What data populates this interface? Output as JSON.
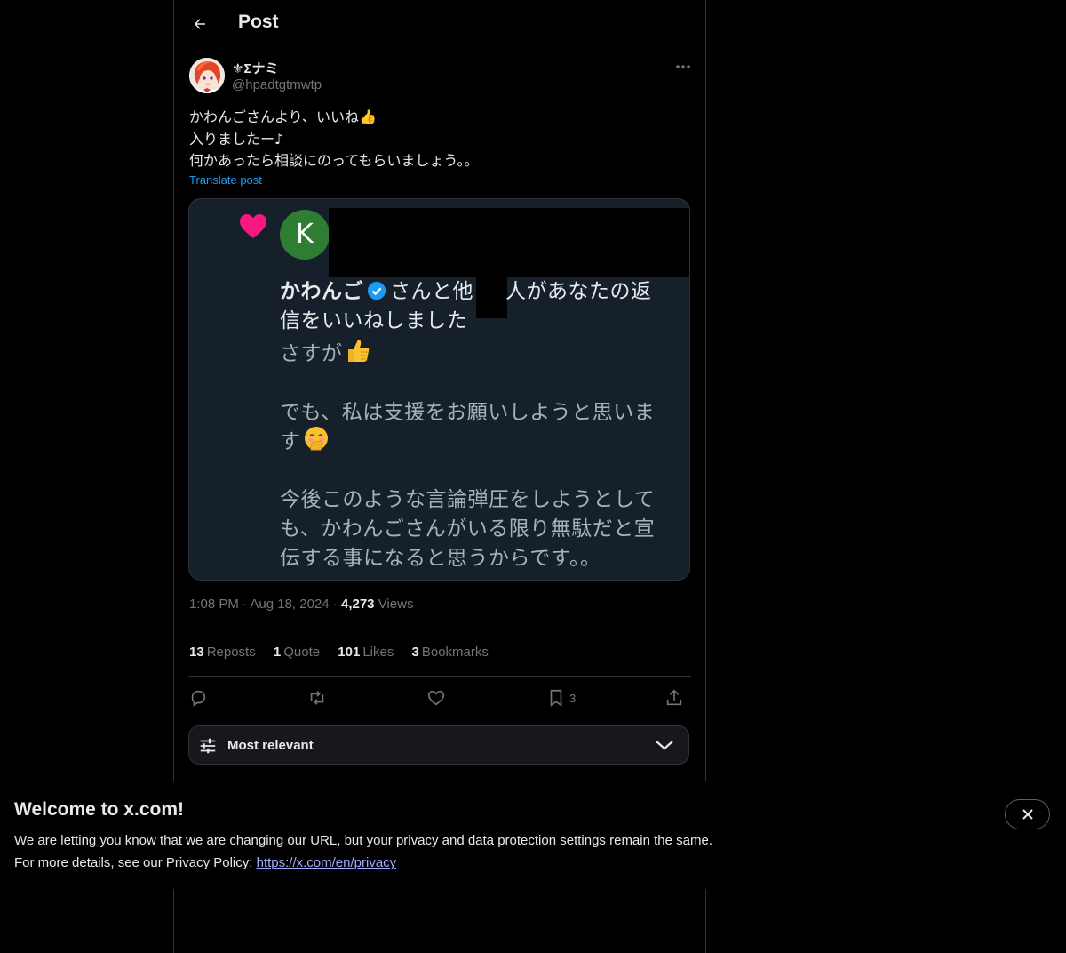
{
  "header": {
    "title": "Post"
  },
  "post": {
    "author": {
      "name": "⚜Σナミ",
      "handle": "@hpadtgtmwtp"
    },
    "text_lines": [
      "かわんごさんより、いいね👍",
      "入りましたー♪",
      "何かあったら相談にのってもらいましょう。。"
    ],
    "translate_label": "Translate post",
    "media": {
      "avatar_letter": "K",
      "notification_name": "かわんご",
      "notification_rest": "さんと他",
      "notification_tail": "人があなたの返",
      "notification_line2": "信をいいねしました",
      "reply_line1": "さすが",
      "reply_line2": "でも、私は支援をお願いしようと思いま",
      "reply_line3": "す",
      "reply_line4": "今後このような言論弾圧をしようとして",
      "reply_line5": "も、かわんごさんがいる限り無駄だと宣",
      "reply_line6": "伝する事になると思うからです。。"
    },
    "time": "1:08 PM",
    "date": "Aug 18, 2024",
    "views_count": "4,273",
    "views_label": "Views",
    "separator": "·",
    "stats": [
      {
        "count": "13",
        "label": "Reposts"
      },
      {
        "count": "1",
        "label": "Quote"
      },
      {
        "count": "101",
        "label": "Likes"
      },
      {
        "count": "3",
        "label": "Bookmarks"
      }
    ],
    "actions": {
      "reply_icon": "reply-icon",
      "repost_icon": "repost-icon",
      "like_icon": "heart-icon",
      "bookmark_icon": "bookmark-icon",
      "bookmark_count": "3",
      "share_icon": "share-icon"
    }
  },
  "sort": {
    "label": "Most relevant"
  },
  "banner": {
    "title": "Welcome to x.com!",
    "text1": "We are letting you know that we are changing our URL, but your privacy and data protection settings remain the same.",
    "text2_prefix": "For more details, see our Privacy Policy:",
    "link": "https://x.com/en/privacy"
  },
  "colors": {
    "background": "#000000",
    "text": "#e7e9ea",
    "muted": "#71767b",
    "accent": "#1d9bf0",
    "border": "#2f3336",
    "heart": "#f91880",
    "link": "#a4a8ff"
  }
}
